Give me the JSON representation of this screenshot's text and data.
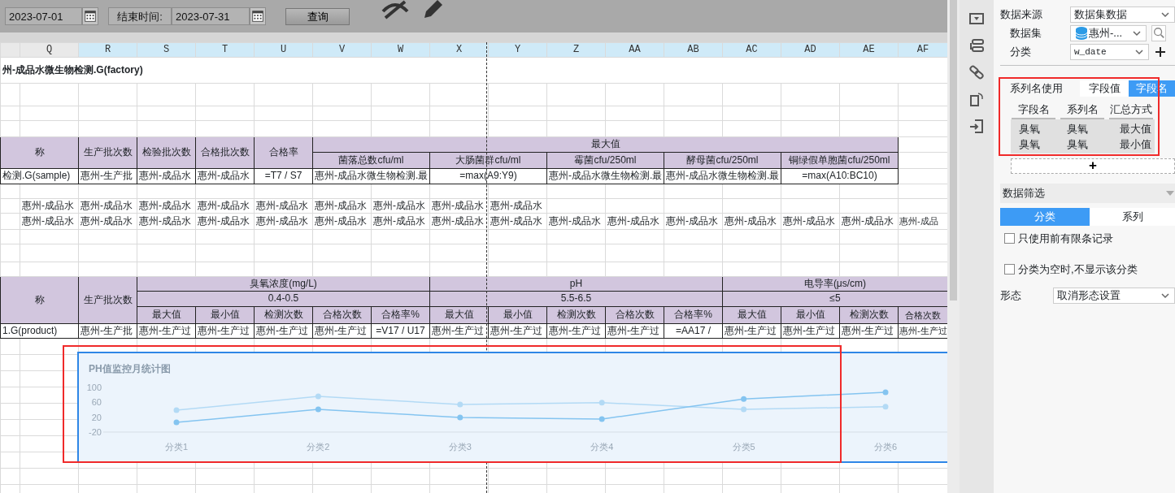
{
  "toolbar": {
    "start_date": "2023-07-01",
    "end_label": "结束时间:",
    "end_date": "2023-07-31",
    "query_button": "查询"
  },
  "column_headers": [
    {
      "selected": false
    },
    {
      "label": "Q",
      "selected": false
    },
    {
      "label": "R",
      "selected": true
    },
    {
      "label": "S",
      "selected": true
    },
    {
      "label": "T",
      "selected": true
    },
    {
      "label": "U",
      "selected": true
    },
    {
      "label": "V",
      "selected": true
    },
    {
      "label": "W",
      "selected": true
    },
    {
      "label": "X",
      "selected": true
    },
    {
      "label": "Y",
      "selected": true
    },
    {
      "label": "Z",
      "selected": true
    },
    {
      "label": "AA",
      "selected": true
    },
    {
      "label": "AB",
      "selected": true
    },
    {
      "label": "AC",
      "selected": true
    },
    {
      "label": "AD",
      "selected": true
    },
    {
      "label": "AE",
      "selected": true
    },
    {
      "label": "AF",
      "selected": true
    }
  ],
  "grid": {
    "rows": [
      {
        "cells": [
          {
            "colspan": 17,
            "kind": "title",
            "text": "州-成品水微生物检测.G(factory)"
          }
        ]
      },
      {
        "cells": [
          {
            "colspan": 2,
            "rowspan": 2,
            "kind": "head",
            "text": "称"
          },
          {
            "rowspan": 2,
            "kind": "head",
            "text": "生产批次数"
          },
          {
            "rowspan": 2,
            "kind": "head",
            "text": "检验批次数"
          },
          {
            "rowspan": 2,
            "kind": "head",
            "text": "合格批次数"
          },
          {
            "rowspan": 2,
            "kind": "head",
            "text": "合格率"
          },
          {
            "colspan": 10,
            "kind": "head",
            "text": "最大值"
          }
        ]
      },
      {
        "cells": [
          {
            "colspan": 2,
            "kind": "head",
            "text": "菌落总数cfu/ml"
          },
          {
            "colspan": 2,
            "kind": "head",
            "text": "大肠菌群cfu/ml"
          },
          {
            "colspan": 2,
            "kind": "head",
            "text": "霉菌cfu/250ml"
          },
          {
            "colspan": 2,
            "kind": "head",
            "text": "酵母菌cfu/250ml"
          },
          {
            "colspan": 2,
            "kind": "head",
            "text": "铜绿假单胞菌cfu/250ml"
          }
        ]
      },
      {
        "cells": [
          {
            "colspan": 2,
            "kind": "data",
            "text": "检测.G(sample)"
          },
          {
            "kind": "data",
            "text": "惠州-生产批"
          },
          {
            "kind": "data",
            "text": "惠州-成品水"
          },
          {
            "kind": "data",
            "text": "惠州-成品水"
          },
          {
            "kind": "formula",
            "text": "=T7 / S7"
          },
          {
            "colspan": 2,
            "kind": "data",
            "text": "惠州-成品水微生物检测.最"
          },
          {
            "colspan": 2,
            "kind": "formula",
            "text": "=max(A9:Y9)"
          },
          {
            "colspan": 2,
            "kind": "data",
            "text": "惠州-成品水微生物检测.最"
          },
          {
            "colspan": 2,
            "kind": "data",
            "text": "惠州-成品水微生物检测.最"
          },
          {
            "colspan": 2,
            "kind": "formula",
            "text": "=max(A10:BC10)"
          }
        ]
      },
      {
        "cells": [
          {},
          {
            "kind": "value",
            "text": "惠州-成品水"
          },
          {
            "kind": "value",
            "text": "惠州-成品水"
          },
          {
            "kind": "value",
            "text": "惠州-成品水"
          },
          {
            "kind": "value",
            "text": "惠州-成品水"
          },
          {
            "kind": "value",
            "text": "惠州-成品水"
          },
          {
            "kind": "value",
            "text": "惠州-成品水"
          },
          {
            "kind": "value",
            "text": "惠州-成品水"
          },
          {
            "kind": "value",
            "text": "惠州-成品水"
          },
          {
            "kind": "value",
            "text": "惠州-成品水"
          }
        ]
      },
      {
        "cells": [
          {},
          {
            "kind": "value",
            "text": "惠州-成品水"
          },
          {
            "kind": "value",
            "text": "惠州-成品水"
          },
          {
            "kind": "value",
            "text": "惠州-成品水"
          },
          {
            "kind": "value",
            "text": "惠州-成品水"
          },
          {
            "kind": "value",
            "text": "惠州-成品水"
          },
          {
            "kind": "value",
            "text": "惠州-成品水"
          },
          {
            "kind": "value",
            "text": "惠州-成品水"
          },
          {
            "kind": "value",
            "text": "惠州-成品水"
          },
          {
            "kind": "value",
            "text": "惠州-成品水"
          },
          {
            "kind": "value",
            "text": "惠州-成品水"
          },
          {
            "kind": "value",
            "text": "惠州-成品水"
          },
          {
            "kind": "value",
            "text": "惠州-成品水"
          },
          {
            "kind": "value",
            "text": "惠州-成品水"
          },
          {
            "kind": "value",
            "text": "惠州-成品水"
          },
          {
            "kind": "value",
            "text": "惠州-成品水"
          },
          {
            "kind": "value",
            "text": "惠州-成品"
          }
        ]
      },
      {
        "cells": [
          {
            "colspan": 2,
            "rowspan": 3,
            "kind": "head",
            "text": "称"
          },
          {
            "rowspan": 3,
            "kind": "head",
            "text": "生产批次数"
          },
          {
            "colspan": 5,
            "kind": "head",
            "text": "臭氧浓度(mg/L)"
          },
          {
            "colspan": 5,
            "kind": "head",
            "text": "pH"
          },
          {
            "colspan": 4,
            "kind": "head",
            "text": "电导率(μs/cm)"
          }
        ]
      },
      {
        "cells": [
          {
            "colspan": 5,
            "kind": "head",
            "text": "0.4-0.5"
          },
          {
            "colspan": 5,
            "kind": "head",
            "text": "5.5-6.5"
          },
          {
            "colspan": 4,
            "kind": "head",
            "text": "≤5"
          }
        ]
      },
      {
        "cells": [
          {
            "kind": "head",
            "text": "最大值"
          },
          {
            "kind": "head",
            "text": "最小值"
          },
          {
            "kind": "head",
            "text": "检测次数"
          },
          {
            "kind": "head",
            "text": "合格次数"
          },
          {
            "kind": "head",
            "text": "合格率%"
          },
          {
            "kind": "head",
            "text": "最大值"
          },
          {
            "kind": "head",
            "text": "最小值"
          },
          {
            "kind": "head",
            "text": "检测次数"
          },
          {
            "kind": "head",
            "text": "合格次数"
          },
          {
            "kind": "head",
            "text": "合格率%"
          },
          {
            "kind": "head",
            "text": "最大值"
          },
          {
            "kind": "head",
            "text": "最小值"
          },
          {
            "kind": "head",
            "text": "检测次数"
          },
          {
            "kind": "head",
            "text": "合格次数"
          }
        ]
      },
      {
        "cells": [
          {
            "colspan": 2,
            "kind": "data",
            "text": "1.G(product)"
          },
          {
            "kind": "data",
            "text": "惠州-生产批"
          },
          {
            "kind": "data",
            "text": "惠州-生产过"
          },
          {
            "kind": "data",
            "text": "惠州-生产过"
          },
          {
            "kind": "data",
            "text": "惠州-生产过"
          },
          {
            "kind": "data",
            "text": "惠州-生产过"
          },
          {
            "kind": "formula",
            "text": "=V17 / U17"
          },
          {
            "kind": "data",
            "text": "惠州-生产过"
          },
          {
            "kind": "data",
            "text": "惠州-生产过"
          },
          {
            "kind": "data",
            "text": "惠州-生产过"
          },
          {
            "kind": "data",
            "text": "惠州-生产过"
          },
          {
            "kind": "formula",
            "text": "=AA17 /"
          },
          {
            "kind": "data",
            "text": "惠州-生产过"
          },
          {
            "kind": "data",
            "text": "惠州-生产过"
          },
          {
            "kind": "data",
            "text": "惠州-生产过"
          },
          {
            "kind": "data",
            "text": "惠州-生产过"
          }
        ]
      }
    ]
  },
  "chart": {
    "selected": true,
    "chart_data": {
      "type": "line",
      "title": "PH值监控月统计图",
      "categories": [
        "分类1",
        "分类2",
        "分类3",
        "分类4",
        "分类5",
        "分类6"
      ],
      "ylim": [
        -20,
        100
      ],
      "yticks": [
        100,
        60,
        20,
        -20
      ],
      "series": [
        {
          "color": "#b3daf5",
          "marker": "circle",
          "values": [
            39,
            76,
            54,
            59,
            41,
            48
          ]
        },
        {
          "color": "#84c4f0",
          "marker": "circle",
          "values": [
            6,
            41,
            19,
            15,
            69,
            87
          ]
        }
      ]
    }
  },
  "panel": {
    "data_source": {
      "label": "数据来源",
      "value": "数据集数据"
    },
    "dataset": {
      "label": "数据集",
      "value": "惠州-..."
    },
    "category": {
      "label": "分类",
      "value": "w_date"
    },
    "series_name": {
      "label": "系列名使用",
      "options": [
        {
          "label": "字段值",
          "selected": false
        },
        {
          "label": "字段名",
          "selected": true
        }
      ]
    },
    "series_table": {
      "columns": [
        "字段名",
        "系列名",
        "汇总方式"
      ],
      "rows": [
        [
          "臭氧",
          "臭氧",
          "最大值"
        ],
        [
          "臭氧",
          "臭氧",
          "最小值"
        ]
      ]
    },
    "add_button": "+",
    "filter": {
      "title": "数据筛选",
      "tabs": [
        {
          "label": "分类",
          "selected": true
        },
        {
          "label": "系列",
          "selected": false
        }
      ],
      "options": [
        {
          "label": "只使用前有限条记录",
          "checked": false
        },
        {
          "label": "分类为空时,不显示该分类",
          "checked": false
        }
      ]
    },
    "shape": {
      "label": "形态",
      "value": "取消形态设置"
    }
  }
}
